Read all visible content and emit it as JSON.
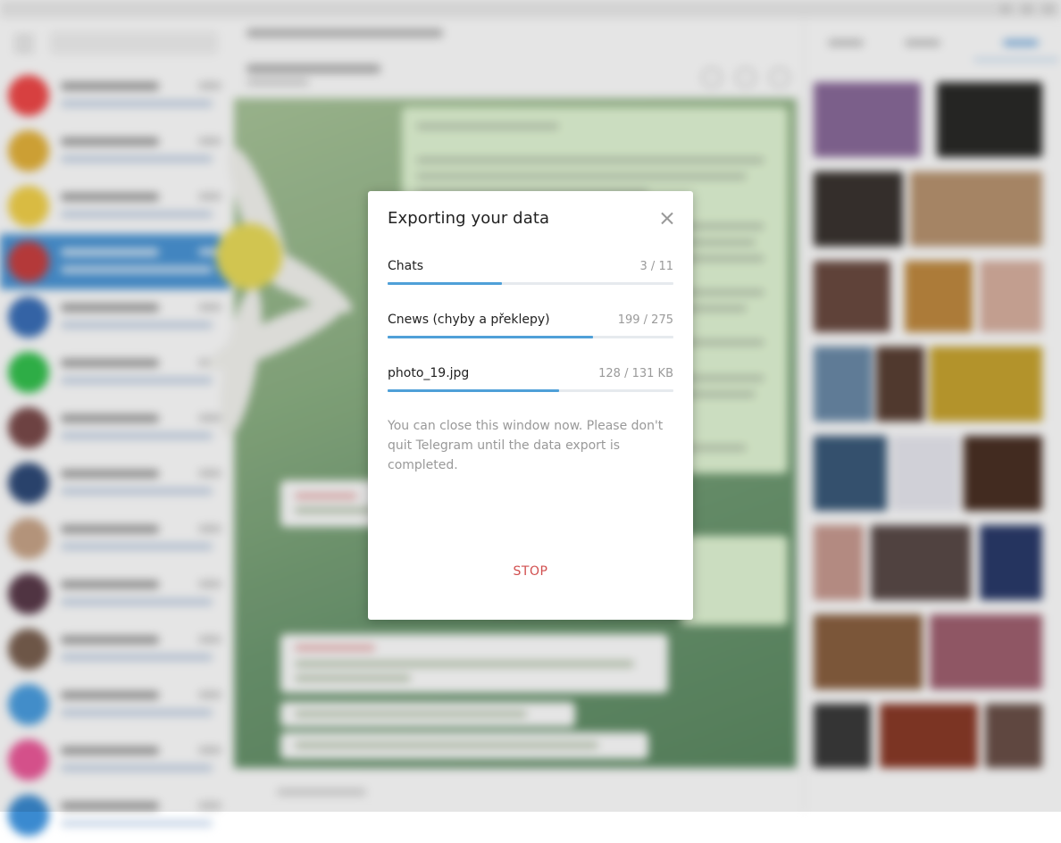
{
  "dialog": {
    "title": "Exporting your data",
    "close_icon": "close-icon",
    "progress": [
      {
        "label": "Chats",
        "count": "3 / 11",
        "fraction": 0.4
      },
      {
        "label": "Cnews (chyby a překlepy)",
        "count": "199 / 275",
        "fraction": 0.72
      },
      {
        "label": "photo_19.jpg",
        "count": "128 / 131 KB",
        "fraction": 0.6
      }
    ],
    "note": "You can close this window now. Please don't quit Telegram until the data export is completed.",
    "stop_label": "STOP"
  },
  "colors": {
    "accent": "#4fa0d8",
    "stop": "#d14e4e",
    "track": "#e6eaee"
  }
}
